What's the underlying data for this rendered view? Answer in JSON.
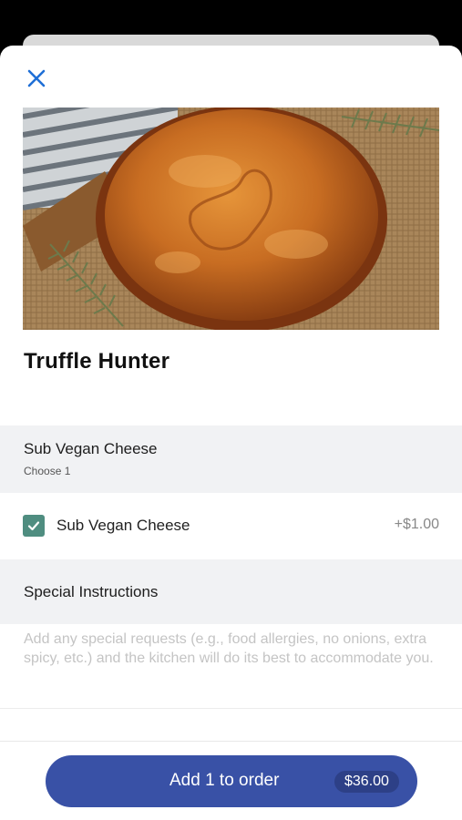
{
  "item": {
    "title": "Truffle Hunter",
    "image_alt": "Golden baked pie on a wooden board with burlap and pine sprigs"
  },
  "modifier_group": {
    "title": "Sub Vegan Cheese",
    "subtitle": "Choose 1",
    "options": [
      {
        "label": "Sub Vegan Cheese",
        "price": "+$1.00",
        "checked": true
      }
    ]
  },
  "special_instructions": {
    "title": "Special Instructions",
    "placeholder": "Add any special requests (e.g., food allergies, no onions, extra spicy, etc.) and the kitchen will do its best to accommodate you.",
    "value": ""
  },
  "footer": {
    "add_label": "Add 1 to order",
    "price": "$36.00"
  },
  "colors": {
    "accent": "#3951a6",
    "checkbox": "#4f8d80",
    "close_icon": "#1f6fd6"
  }
}
